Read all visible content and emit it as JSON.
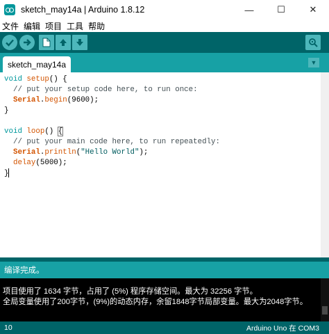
{
  "window": {
    "title": "sketch_may14a | Arduino 1.8.12",
    "minimize_glyph": "—",
    "maximize_glyph": "☐",
    "close_glyph": "✕"
  },
  "menu": [
    "文件",
    "编辑",
    "项目",
    "工具",
    "帮助"
  ],
  "toolbar": {
    "icons": [
      "verify-icon",
      "upload-icon",
      "new-icon",
      "open-icon",
      "save-icon",
      "serial-monitor-icon"
    ],
    "accent": "#4db7bb"
  },
  "tabs": {
    "active": "sketch_may14a",
    "menu_glyph": "▼"
  },
  "code": [
    {
      "parts": [
        [
          "kw",
          "void"
        ],
        [
          "",
          " "
        ],
        [
          "fn",
          "setup"
        ],
        [
          "",
          "() {"
        ]
      ]
    },
    {
      "parts": [
        [
          "cmt",
          "  // put your setup code here, to run once:"
        ]
      ]
    },
    {
      "parts": [
        [
          "",
          "  "
        ],
        [
          "obj",
          "Serial"
        ],
        [
          "",
          "."
        ],
        [
          "fn",
          "begin"
        ],
        [
          "",
          "(9600);"
        ]
      ]
    },
    {
      "parts": [
        [
          "",
          "}"
        ]
      ]
    },
    {
      "parts": [
        [
          "",
          ""
        ]
      ]
    },
    {
      "parts": [
        [
          "kw",
          "void"
        ],
        [
          "",
          " "
        ],
        [
          "fn",
          "loop"
        ],
        [
          "",
          "() "
        ],
        [
          "hl",
          "{"
        ]
      ]
    },
    {
      "parts": [
        [
          "cmt",
          "  // put your main code here, to run repeatedly:"
        ]
      ]
    },
    {
      "parts": [
        [
          "",
          "  "
        ],
        [
          "obj",
          "Serial"
        ],
        [
          "",
          "."
        ],
        [
          "fn",
          "println"
        ],
        [
          "",
          "("
        ],
        [
          "str",
          "\"Hello World\""
        ],
        [
          "",
          ");"
        ]
      ]
    },
    {
      "parts": [
        [
          "",
          "  "
        ],
        [
          "fn",
          "delay"
        ],
        [
          "",
          "(5000);"
        ]
      ]
    },
    {
      "parts": [
        [
          "",
          "}"
        ]
      ]
    }
  ],
  "status": "编译完成。",
  "console": [
    "项目使用了 1634 字节，占用了 (5%) 程序存储空间。最大为 32256 字节。",
    "全局变量使用了200字节，(9%)的动态内存，余留1848字节局部变量。最大为2048字节。"
  ],
  "bottom": {
    "line_number": "10",
    "board": "Arduino Uno 在 COM3"
  },
  "colors": {
    "dark_teal": "#006468",
    "teal": "#17a1a5",
    "keyword": "#00979c",
    "function": "#d35400"
  }
}
